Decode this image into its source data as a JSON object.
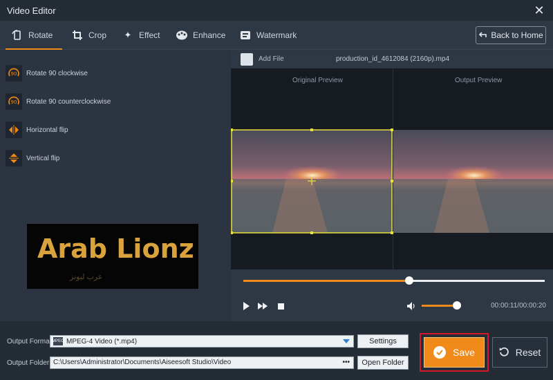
{
  "window": {
    "title": "Video Editor"
  },
  "tabs": [
    {
      "label": "Rotate",
      "icon": "rotate-icon",
      "active": true
    },
    {
      "label": "Crop",
      "icon": "crop-icon"
    },
    {
      "label": "Effect",
      "icon": "effect-icon"
    },
    {
      "label": "Enhance",
      "icon": "enhance-icon"
    },
    {
      "label": "Watermark",
      "icon": "watermark-icon"
    }
  ],
  "header": {
    "back_label": "Back to Home"
  },
  "rotate_options": [
    {
      "label": "Rotate 90 clockwise",
      "icon": "rotate-cw-icon",
      "badge": "90"
    },
    {
      "label": "Rotate 90 counterclockwise",
      "icon": "rotate-ccw-icon",
      "badge": "90"
    },
    {
      "label": "Horizontal flip",
      "icon": "horizontal-flip-icon"
    },
    {
      "label": "Vertical flip",
      "icon": "vertical-flip-icon"
    }
  ],
  "logo": {
    "text": "Arab Lionz",
    "subtext": "عرب ليونز"
  },
  "file": {
    "add_label": "Add File",
    "name": "production_id_4612084 (2160p).mp4"
  },
  "preview": {
    "original_label": "Original Preview",
    "output_label": "Output Preview"
  },
  "playback": {
    "position": 0.55,
    "volume": 0.95,
    "time": "00:00:11/00:00:20"
  },
  "output": {
    "format_label": "Output Format:",
    "format_badge": "MPEG",
    "format_value": "MPEG-4 Video (*.mp4)",
    "settings_label": "Settings",
    "folder_label": "Output Folder:",
    "folder_value": "C:\\Users\\Administrator\\Documents\\Aiseesoft Studio\\Video",
    "folder_dots": "•••",
    "open_folder_label": "Open Folder"
  },
  "actions": {
    "save_label": "Save",
    "reset_label": "Reset"
  },
  "colors": {
    "accent": "#f08a18",
    "highlight": "#d3182b",
    "crop_frame": "#e8e23a"
  }
}
